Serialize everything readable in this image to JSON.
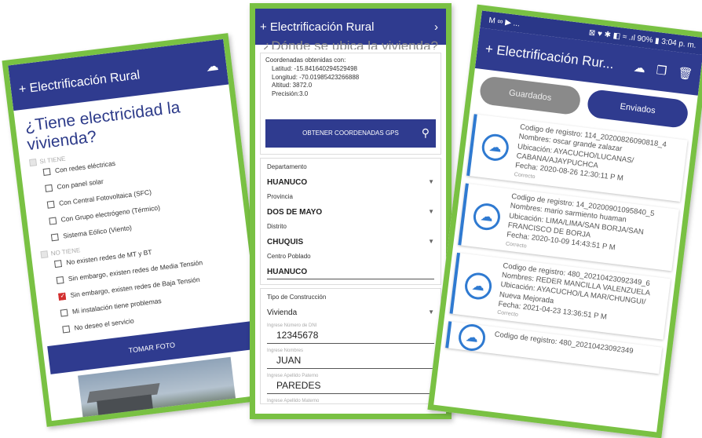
{
  "app_title": "+ Electrificación Rural",
  "phone1": {
    "upload_icon": "cloud-upload-icon",
    "question": "¿Tiene electricidad la vivienda?",
    "yes_group": "SI TIENE",
    "yes_options": [
      {
        "label": "Con redes eléctricas",
        "checked": false
      },
      {
        "label": "Con panel solar",
        "checked": false
      },
      {
        "label": "Con Central Fotovoltaica (SFC)",
        "checked": false
      },
      {
        "label": "Con Grupo electrógeno (Térmico)",
        "checked": false
      },
      {
        "label": "Sistema Eólico (Viento)",
        "checked": false
      }
    ],
    "no_group": "NO TIENE",
    "no_options": [
      {
        "label": "No existen redes de MT y BT",
        "checked": false
      },
      {
        "label": "Sin embargo, existen redes de Media Tensión",
        "checked": false
      },
      {
        "label": "Sin embargo, existen redes de Baja Tensión",
        "checked": true
      },
      {
        "label": "Mi instalación tiene problemas",
        "checked": false
      },
      {
        "label": "No deseo el servicio",
        "checked": false
      }
    ],
    "photo_button": "TOMAR FOTO"
  },
  "phone2": {
    "header_partial": "¿Dónde se ubica la vivienda?",
    "coords_title": "Coordenadas obtenidas con:",
    "coords": [
      "Latitud: -15.841640294529498",
      "Longitud: -70.01985423266888",
      "Altitud: 3872.0",
      "Precisión:3.0"
    ],
    "gps_button": "OBTENER COORDENADAS GPS",
    "departamento_label": "Departamento",
    "departamento": "HUANUCO",
    "provincia_label": "Provincia",
    "provincia": "DOS DE MAYO",
    "distrito_label": "Distrito",
    "distrito": "CHUQUIS",
    "centro_label": "Centro Poblado",
    "centro": "HUANUCO",
    "tipo_label": "Tipo de Construcción",
    "tipo": "Vivienda",
    "dni_label": "Ingrese Número de DNI",
    "dni": "12345678",
    "nombres_label": "Ingrese Nombres",
    "nombres": "JUAN",
    "paterno_label": "Ingrese Apellido Paterno",
    "paterno": "PAREDES",
    "materno_label": "Ingrese Apellido Materno"
  },
  "phone3": {
    "status_left": "M ∞ ▶ ...",
    "status_right": "⊠ ♥ ✱ ◧ ≈ .ıl 90% ▮ 3:04 p. m.",
    "title": "+ Electrificación Rur...",
    "tab_saved": "Guardados",
    "tab_sent": "Enviados",
    "records": [
      {
        "code": "Codigo de registro: 114_20200826090818_4",
        "name": "Nombres: oscar grande zalazar",
        "location": "Ubicación: AYACUCHO/LUCANAS/ CABANA/AJAYPUCHCA",
        "date": "Fecha: 2020-08-26 12:30:11 P M",
        "status": "Correcto"
      },
      {
        "code": "Codigo de registro: 14_20200901095840_5",
        "name": "Nombres: mario sarmiento huaman",
        "location": "Ubicación: LIMA/LIMA/SAN BORJA/SAN FRANCISCO DE BORJA",
        "date": "Fecha: 2020-10-09 14:43:51 P M",
        "status": "Correcto"
      },
      {
        "code": "Codigo de registro: 480_20210423092349_6",
        "name": "Nombres: REDER MANCILLA VALENZUELA",
        "location": "Ubicación: AYACUCHO/LA MAR/CHUNGUI/ Nueva Mejorada",
        "date": "Fecha: 2021-04-23 13:36:51 P M",
        "status": "Correcto"
      },
      {
        "code": "Codigo de registro: 480_20210423092349",
        "name": "",
        "location": "",
        "date": "",
        "status": ""
      }
    ]
  }
}
